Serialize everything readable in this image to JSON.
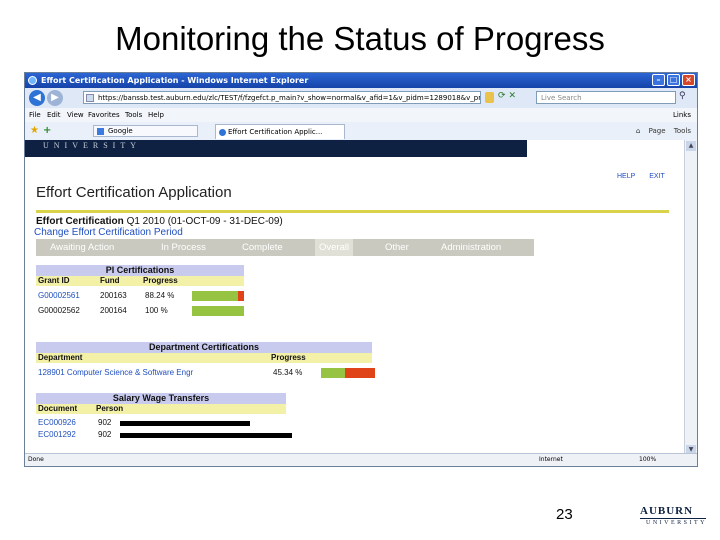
{
  "slide": {
    "title": "Monitoring the Status of Progress",
    "page_number": "23",
    "logo_word": "AUBURN",
    "logo_sub": "UNIVERSITY"
  },
  "browser": {
    "title": "Effort Certification Application - Windows Internet Explorer",
    "url": "https://banssb.test.auburn.edu/zlc/TEST/f/fzgefct.p_main?v_show=normal&v_afid=1&v_pidm=1289018&v_prp_ct",
    "search_placeholder": "Live Search",
    "menu": [
      "File",
      "Edit",
      "View",
      "Favorites",
      "Tools",
      "Help"
    ],
    "links_label": "Links",
    "google_tab": "Google",
    "active_tab": "Effort Certification Applic...",
    "page_label": "Page",
    "tools_label": "Tools",
    "status_done": "Done",
    "status_zone": "Internet",
    "status_zoom": "100%"
  },
  "app": {
    "university_banner": "UNIVERSITY",
    "title": "Effort Certification Application",
    "help_link": "HELP",
    "exit_link": "EXIT",
    "ec_label": "Effort Certification",
    "ec_dates": "Q1 2010 (01-OCT-09 - 31-DEC-09)",
    "change_link": "Change Effort Certification Period",
    "tabs": [
      "Awaiting Action",
      "In Process",
      "Complete",
      "Overall",
      "Other",
      "Administration"
    ],
    "active_tab": "Overall"
  },
  "pi_certifications": {
    "heading": "PI Certifications",
    "columns": [
      "Grant ID",
      "Fund",
      "Progress"
    ],
    "rows": [
      {
        "grant_id": "G00002561",
        "fund": "200163",
        "progress": "88.24 %",
        "progress_value": 88.24
      },
      {
        "grant_id": "G00002562",
        "fund": "200164",
        "progress": "100 %",
        "progress_value": 100
      }
    ]
  },
  "department_certifications": {
    "heading": "Department Certifications",
    "columns": [
      "Department",
      "Progress"
    ],
    "rows": [
      {
        "department": "128901 Computer Science & Software Engr",
        "progress": "45.34 %",
        "progress_value": 45.34
      }
    ]
  },
  "salary_wage_transfers": {
    "heading": "Salary Wage Transfers",
    "columns": [
      "Document",
      "Person"
    ],
    "rows": [
      {
        "document": "EC000926",
        "person": "902"
      },
      {
        "document": "EC001292",
        "person": "902"
      }
    ]
  },
  "colors": {
    "progress_done": "#96c341",
    "progress_remaining": "#e04318",
    "section_header": "#c8cbee",
    "column_header": "#f3f0a8",
    "banner": "#0e2142"
  }
}
